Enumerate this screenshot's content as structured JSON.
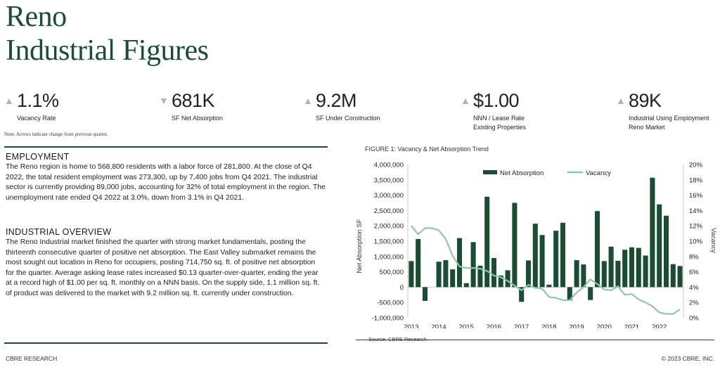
{
  "title": {
    "line1": "Reno",
    "line2": "Industrial Figures"
  },
  "stats": [
    {
      "direction": "up",
      "value": "1.1%",
      "label1": "Vacancy Rate",
      "label2": ""
    },
    {
      "direction": "down",
      "value": "681K",
      "label1": "SF Net Absorption",
      "label2": ""
    },
    {
      "direction": "up",
      "value": "9.2M",
      "label1": "SF Under Construction",
      "label2": ""
    },
    {
      "direction": "up",
      "value": "$1.00",
      "label1": "NNN / Lease Rate",
      "label2": "Existing Properties"
    },
    {
      "direction": "up",
      "value": "89K",
      "label1": "Industrial Using Employment",
      "label2": "Reno Market"
    }
  ],
  "note": "Note: Arrows indicate change from previous quarter.",
  "employment": {
    "heading": "EMPLOYMENT",
    "body": "The Reno region is home to 568,800 residents with a labor force of 281,800. At the close of Q4 2022, the total resident employment was 273,300, up by 7,400 jobs from Q4 2021. The industrial sector is currently providing 89,000 jobs, accounting for 32% of total employment in the region. The unemployment rate ended Q4 2022 at 3.0%, down from 3.1% in Q4 2021."
  },
  "overview": {
    "heading": "INDUSTRIAL OVERVIEW",
    "body": "The Reno Industrial market finished the quarter with strong market fundamentals, posting the thirteenth consecutive quarter of positive net absorption. The East Valley submarket remains the most sought out location in Reno for occupiers, posting 714,750 sq. ft. of positive net absorption for the quarter. Average asking lease rates increased $0.13 quarter-over-quarter, ending the year at a record high of $1.00 per sq. ft. monthly on a NNN basis. On the supply side, 1.1 million sq. ft. of product was delivered to the market with 9.2 million sq. ft. currently under construction."
  },
  "figure": {
    "title": "FIGURE 1: Vacancy & Net Absorption Trend",
    "source": "Source: CBRE Research"
  },
  "colors": {
    "brand": "#1a4d33",
    "bar": "#1a4d33",
    "vacancy": "#8fc7ad",
    "arrow": "#b3b3b3"
  },
  "chart_data": {
    "type": "bar",
    "ylabel": "Net Absorption SF",
    "y2label": "Vacancy",
    "ylim": [
      -1000000,
      4000000
    ],
    "y2lim": [
      0,
      20
    ],
    "y_ticks": [
      "4,000,000",
      "3,500,000",
      "3,000,000",
      "2,500,000",
      "2,000,000",
      "1,500,000",
      "1,000,000",
      "500,000",
      "0",
      "-500,000",
      "-1,000,000"
    ],
    "y2_ticks": [
      "20%",
      "18%",
      "16%",
      "14%",
      "12%",
      "10%",
      "8%",
      "6%",
      "4%",
      "2%",
      "0%"
    ],
    "x_ticks": [
      "2013",
      "2014",
      "2015",
      "2016",
      "2017",
      "2018",
      "2019",
      "2020",
      "2021",
      "2022"
    ],
    "legend_position": "top-right",
    "series": [
      {
        "name": "Net Absorption",
        "type": "bar",
        "values": [
          850000,
          1570000,
          -450000,
          0,
          830000,
          880000,
          580000,
          1600000,
          130000,
          1470000,
          700000,
          2950000,
          950000,
          380000,
          550000,
          2750000,
          -480000,
          870000,
          2070000,
          1700000,
          80000,
          1840000,
          2100000,
          -430000,
          880000,
          740000,
          -420000,
          2480000,
          850000,
          1320000,
          860000,
          1220000,
          1300000,
          1280000,
          1030000,
          3570000,
          2700000,
          2330000,
          750000,
          690000
        ]
      },
      {
        "name": "Vacancy",
        "type": "line",
        "values": [
          12.0,
          10.9,
          11.7,
          11.7,
          11.4,
          10.3,
          8.1,
          6.7,
          6.5,
          6.5,
          6.4,
          6.1,
          5.5,
          5.3,
          4.8,
          4.2,
          3.6,
          4.3,
          3.9,
          3.8,
          2.7,
          2.6,
          2.3,
          2.3,
          3.3,
          4.0,
          5.0,
          4.4,
          3.7,
          3.6,
          4.1,
          3.0,
          3.1,
          2.4,
          2.0,
          1.5,
          0.7,
          0.5,
          0.5,
          1.1
        ]
      }
    ]
  },
  "footer": {
    "left": "CBRE RESEARCH",
    "right": "© 2023 CBRE, INC."
  }
}
